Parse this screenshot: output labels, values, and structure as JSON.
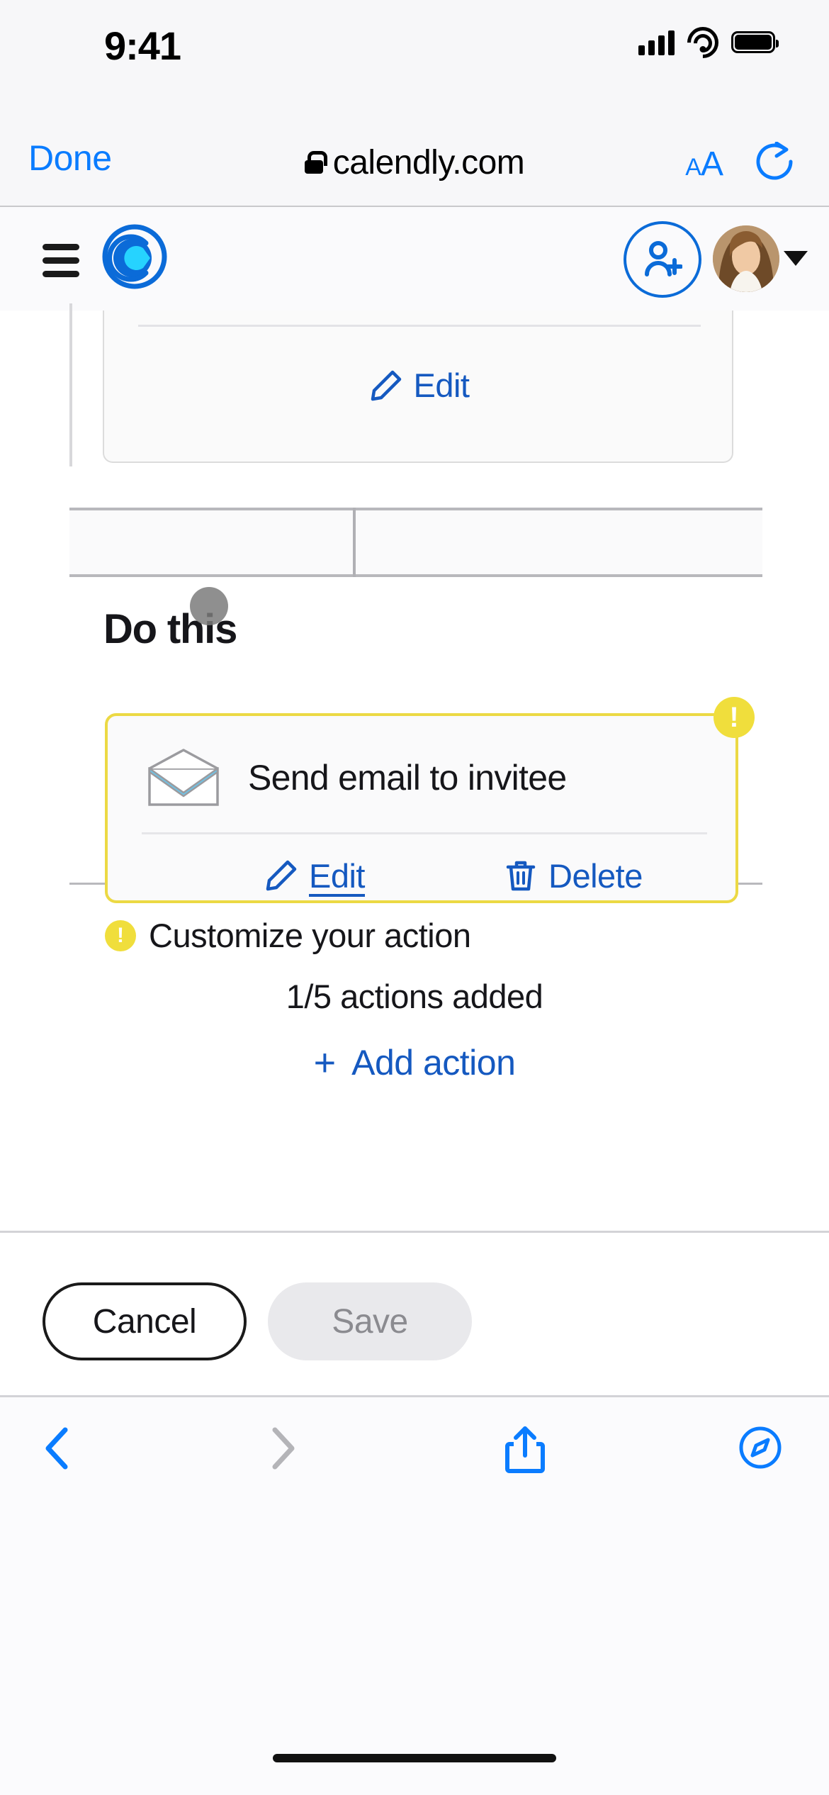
{
  "status_bar": {
    "time": "9:41",
    "cellular_icon": "signal-bars-icon",
    "wifi_icon": "wifi-icon",
    "battery_icon": "battery-icon"
  },
  "safari_top": {
    "done_label": "Done",
    "lock_icon": "lock-icon",
    "url": "calendly.com",
    "text_size_small": "A",
    "text_size_large": "A",
    "reload_icon": "reload-icon"
  },
  "calendly_header": {
    "menu_icon": "hamburger-menu-icon",
    "logo_icon": "calendly-logo-icon",
    "invite_icon": "add-person-icon",
    "avatar_icon": "user-avatar",
    "caret_icon": "chevron-down-icon"
  },
  "top_card": {
    "edit_label": "Edit",
    "edit_icon": "pencil-icon"
  },
  "do_this": {
    "heading": "Do this",
    "action": {
      "warning_badge": "!",
      "icon": "envelope-icon",
      "title": "Send email to invitee",
      "edit_label": "Edit",
      "edit_icon": "pencil-icon",
      "delete_label": "Delete",
      "delete_icon": "trash-icon"
    },
    "customize_badge": "!",
    "customize_text": "Customize your action",
    "count_text": "1/5 actions added",
    "add_action_plus": "+",
    "add_action_label": "Add action"
  },
  "footer": {
    "cancel_label": "Cancel",
    "save_label": "Save"
  },
  "bottom_toolbar": {
    "back_icon": "chevron-left-icon",
    "forward_icon": "chevron-right-icon",
    "share_icon": "share-icon",
    "tabs_icon": "compass-icon"
  },
  "colors": {
    "accent_blue": "#1559c0",
    "ios_blue": "#0a7cff",
    "warning_yellow": "#f0de3c",
    "card_border_yellow": "#ecd944",
    "text_dark": "#16161a",
    "disabled_gray": "#8b8b90"
  }
}
